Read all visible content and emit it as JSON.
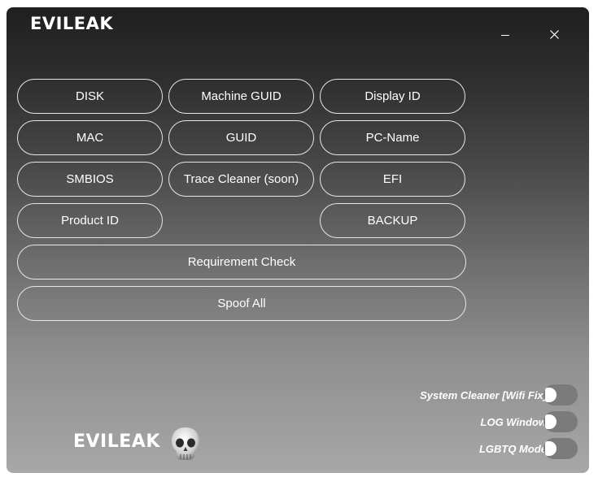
{
  "app": {
    "brand": "EVILEAK",
    "bottom_brand": "EVILEAK"
  },
  "buttons": {
    "disk": "DISK",
    "machine_guid": "Machine GUID",
    "display_id": "Display ID",
    "mac": "MAC",
    "guid": "GUID",
    "pc_name": "PC-Name",
    "smbios": "SMBIOS",
    "trace_cleaner": "Trace Cleaner (soon)",
    "efi": "EFI",
    "product_id": "Product ID",
    "backup": "BACKUP",
    "requirement_check": "Requirement Check",
    "spoof_all": "Spoof All"
  },
  "toggles": {
    "system_cleaner": {
      "label": "System Cleaner [Wifi Fix]",
      "on": false
    },
    "log_window": {
      "label": "LOG Window",
      "on": false
    },
    "lgbtq_mode": {
      "label": "LGBTQ Mode",
      "on": false
    }
  },
  "icons": {
    "minimize": "minimize-icon",
    "close": "close-icon",
    "skull": "skull-icon"
  },
  "colors": {
    "button_border": "#e6e6e6",
    "text": "#ffffff",
    "toggle_track": "#7b7b7b"
  }
}
